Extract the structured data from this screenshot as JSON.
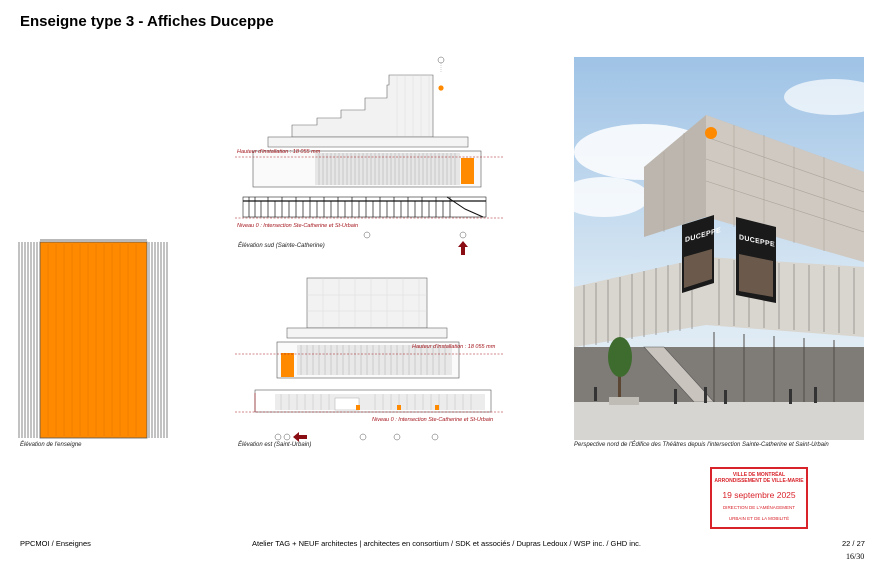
{
  "page": {
    "title": "Enseigne type 3 - Affiches Duceppe",
    "footer_left": "PPCMOI / Enseignes",
    "footer_center": "Atelier TAG + NEUF architectes | architectes en consortium / SDK et associés / Dupras Ledoux / WSP inc. / GHD inc.",
    "page_number": "22 / 27",
    "page_stamp_number": "16/30"
  },
  "captions": {
    "sign_elevation": "Élévation de l'enseigne",
    "south_elevation": "Élévation sud (Sainte-Catherine)",
    "east_elevation": "Élévation est (Saint-Urbain)",
    "perspective": "Perspective nord de l'Édifice des Théâtres depuis l'intersection Sainte-Catherine et Saint-Urbain"
  },
  "annotations": {
    "south_height": "Hauteur d'installation : 18 055 mm",
    "south_level": "Niveau 0 : Intersection Ste-Catherine et St-Urbain",
    "east_height": "Hauteur d'installation : 18 055 mm",
    "east_level": "Niveau 0 : Intersection Ste-Catherine et St-Urbain"
  },
  "render": {
    "billboard_text": "DUCEPPE"
  },
  "stamp": {
    "line1": "VILLE DE MONTRÉAL",
    "line2": "ARRONDISSEMENT DE VILLE-MARIE",
    "date": "19 septembre 2025",
    "line3": "DIRECTION DE L'AMÉNAGEMENT",
    "line4": "URBAIN ET DE LA MOBILITÉ"
  },
  "colors": {
    "sign_orange": "#ff8a00",
    "annotation_red": "#a3141b",
    "stamp_red": "#d8232a"
  }
}
